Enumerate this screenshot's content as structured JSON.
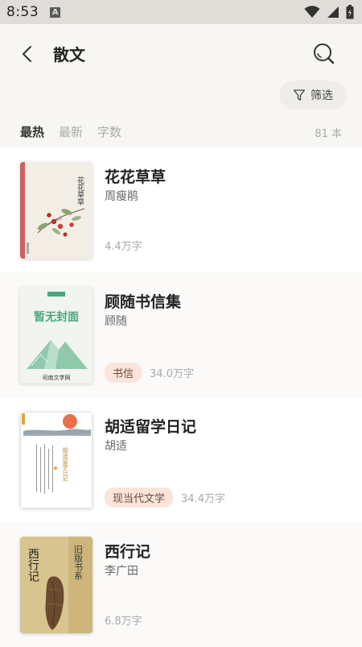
{
  "status": {
    "time": "8:53",
    "notification_glyph": "A"
  },
  "header": {
    "title": "散文",
    "back_icon": "back-chevron-icon",
    "search_icon": "search-icon"
  },
  "filter": {
    "label": "筛选",
    "icon": "filter-icon"
  },
  "sort": {
    "tabs": [
      "最热",
      "最新",
      "字数"
    ],
    "active": 0,
    "count": "81 本"
  },
  "books": [
    {
      "title": "花花草草",
      "author": "周瘦鹃",
      "tag": "",
      "words": "4.4万字",
      "cover": {
        "title_text": "花花草草",
        "accent": "#c9635f"
      }
    },
    {
      "title": "顾随书信集",
      "author": "顾随",
      "tag": "书信",
      "words": "34.0万字",
      "cover": {
        "placeholder_text": "暂无封面",
        "brand": "司南文学网",
        "accent": "#4aa77e"
      }
    },
    {
      "title": "胡适留学日记",
      "author": "胡适",
      "tag": "现当代文学",
      "words": "34.4万字",
      "cover": {
        "title_text": "胡适留学日记",
        "accent": "#e8714a"
      }
    },
    {
      "title": "西行记",
      "author": "李广田",
      "tag": "",
      "words": "6.8万字",
      "cover": {
        "title_text": "西行记",
        "series_text": "旧版书系",
        "accent": "#6b4a2f"
      }
    }
  ],
  "colors": {
    "background": "#f8f6f3",
    "tag_bg": "#fbe4da",
    "status_bar": "#e0ddd9"
  }
}
